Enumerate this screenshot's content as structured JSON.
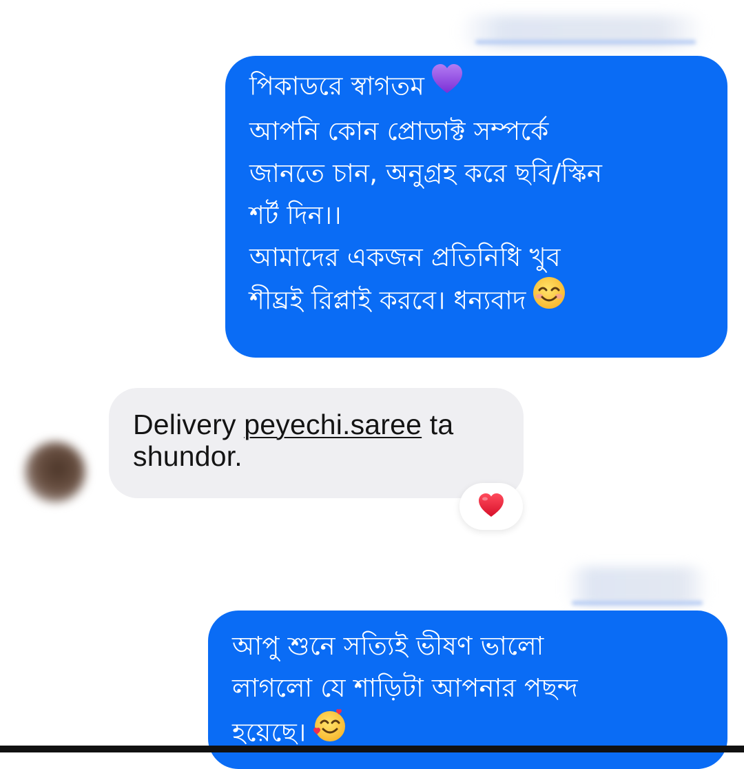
{
  "messages": [
    {
      "direction": "outgoing",
      "lines": [
        "পিকাডরে স্বাগতম",
        "আপনি কোন প্রোডাক্ট সম্পর্কে",
        "জানতে চান, অনুগ্রহ করে ছবি/স্কিন",
        "শর্ট দিন।।",
        "আমাদের একজন প্রতিনিধি খুব",
        "শীঘ্রই রিপ্লাই করবে। ধন্যবাদ"
      ],
      "emojis": [
        "purple-heart",
        "smiling-face-with-smiling-eyes"
      ]
    },
    {
      "direction": "incoming",
      "text_parts": [
        "Delivery ",
        "peyechi.saree",
        " ta",
        "shundor."
      ],
      "reaction": "red-heart"
    },
    {
      "direction": "outgoing",
      "lines": [
        "আপু শুনে সত্যিই ভীষণ ভালো",
        "লাগলো যে শাড়িটা আপনার পছন্দ",
        "হয়েছে।"
      ],
      "emojis": [
        "smiling-face-with-hearts"
      ]
    }
  ],
  "colors": {
    "outgoing_bubble": "#0a6cf5",
    "incoming_bubble": "#efeff2",
    "outgoing_text": "#ffffff",
    "incoming_text": "#141414"
  }
}
